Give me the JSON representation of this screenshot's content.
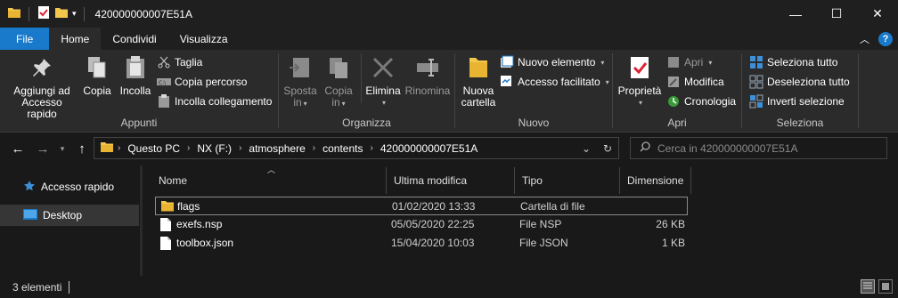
{
  "window": {
    "title": "420000000007E51A",
    "minimize": "—",
    "maximize": "☐",
    "close": "✕"
  },
  "tabs": {
    "file": "File",
    "home": "Home",
    "share": "Condividi",
    "view": "Visualizza"
  },
  "ribbon": {
    "clipboard": {
      "label": "Appunti",
      "pin": "Aggiungi ad Accesso rapido",
      "pin_line1": "Aggiungi ad",
      "pin_line2": "Accesso rapido",
      "copy": "Copia",
      "paste": "Incolla",
      "cut": "Taglia",
      "copy_path": "Copia percorso",
      "paste_shortcut": "Incolla collegamento"
    },
    "organize": {
      "label": "Organizza",
      "move_line1": "Sposta",
      "move_line2": "in",
      "copy_line1": "Copia",
      "copy_line2": "in",
      "delete": "Elimina",
      "rename": "Rinomina"
    },
    "new": {
      "label": "Nuovo",
      "folder_line1": "Nuova",
      "folder_line2": "cartella",
      "new_item": "Nuovo elemento",
      "easy_access": "Accesso facilitato"
    },
    "open": {
      "label": "Apri",
      "properties": "Proprietà",
      "open": "Apri",
      "edit": "Modifica",
      "history": "Cronologia"
    },
    "select": {
      "label": "Seleziona",
      "select_all": "Seleziona tutto",
      "select_none": "Deseleziona tutto",
      "invert": "Inverti selezione"
    }
  },
  "address": {
    "crumbs": [
      "Questo PC",
      "NX (F:)",
      "atmosphere",
      "contents",
      "420000000007E51A"
    ],
    "search_placeholder": "Cerca in 420000000007E51A"
  },
  "navpane": {
    "items": [
      {
        "label": "Accesso rapido"
      },
      {
        "label": "Desktop"
      }
    ]
  },
  "columns": {
    "name": "Nome",
    "modified": "Ultima modifica",
    "type": "Tipo",
    "size": "Dimensione"
  },
  "files": [
    {
      "name": "flags",
      "modified": "01/02/2020 13:33",
      "type": "Cartella di file",
      "size": ""
    },
    {
      "name": "exefs.nsp",
      "modified": "05/05/2020 22:25",
      "type": "File NSP",
      "size": "26 KB"
    },
    {
      "name": "toolbox.json",
      "modified": "15/04/2020 10:03",
      "type": "File JSON",
      "size": "1 KB"
    }
  ],
  "status": {
    "count": "3 elementi"
  },
  "colors": {
    "accent": "#1979ca",
    "folder": "#f3c74c",
    "background": "#191919"
  }
}
